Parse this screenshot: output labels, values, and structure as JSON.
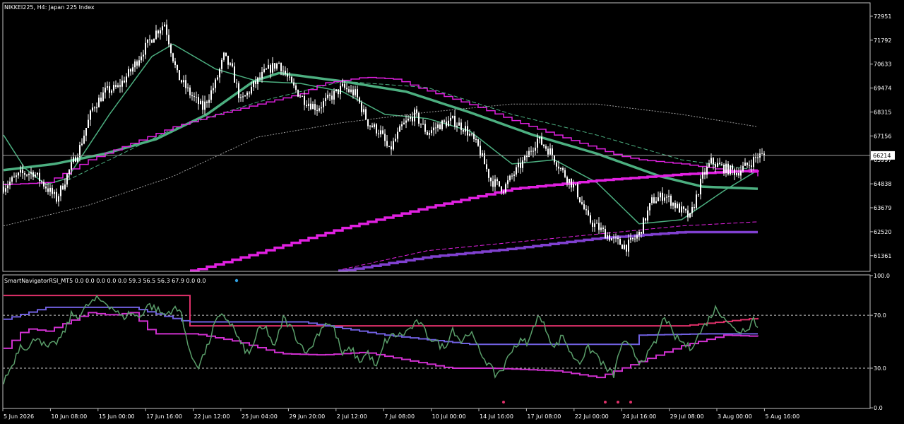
{
  "window": {
    "title": "NIKKEI225, H4:  Japan 225 Index",
    "indicator_label": "SmartNavigatorRSI_MT5 0.0 0.0 0.0 0.0 0.0 59.3 56.5 56.3 67.9 0.0 0.0",
    "current_price": "66214"
  },
  "colors": {
    "background": "#000000",
    "grid": "#c0c0c0",
    "text": "#ffffff",
    "candle": "#ffffff",
    "ma_green": "#4caf80",
    "magenta": "#e020e0",
    "purple": "#8040d0",
    "rsi_line": "#5a9e6a",
    "rsi_red": "#e0306a",
    "rsi_blue": "#7060e0",
    "rsi_magenta": "#d030d0",
    "dot_pink": "#e0306a",
    "dot_blue": "#30a0e0"
  },
  "chart_data": [
    {
      "type": "candlestick",
      "symbol": "NIKKEI225",
      "timeframe": "H4",
      "ylim": [
        60600,
        73600
      ],
      "y_ticks": [
        "72951",
        "71792",
        "70633",
        "69474",
        "68315",
        "67156",
        "65997",
        "64838",
        "63679",
        "62520",
        "61361"
      ],
      "x_ticks": [
        "5 Jun 2026",
        "10 Jun 08:00",
        "15 Jun 00:00",
        "17 Jun 16:00",
        "22 Jun 12:00",
        "25 Jun 04:00",
        "29 Jun 20:00",
        "2 Jul 12:00",
        "7 Jul 08:00",
        "10 Jul 00:00",
        "14 Jul 16:00",
        "17 Jul 08:00",
        "22 Jul 00:00",
        "24 Jul 16:00",
        "29 Jul 08:00",
        "3 Aug 00:00",
        "5 Aug 16:00"
      ],
      "price_anchors": [
        [
          0,
          64700
        ],
        [
          8,
          65300
        ],
        [
          14,
          65400
        ],
        [
          20,
          64700
        ],
        [
          25,
          64100
        ],
        [
          32,
          65700
        ],
        [
          36,
          66600
        ],
        [
          42,
          68500
        ],
        [
          48,
          69300
        ],
        [
          54,
          69500
        ],
        [
          60,
          70300
        ],
        [
          66,
          71300
        ],
        [
          72,
          72200
        ],
        [
          76,
          72600
        ],
        [
          82,
          70100
        ],
        [
          88,
          69200
        ],
        [
          94,
          68500
        ],
        [
          100,
          69700
        ],
        [
          104,
          71000
        ],
        [
          108,
          70300
        ],
        [
          112,
          68800
        ],
        [
          118,
          69600
        ],
        [
          124,
          70300
        ],
        [
          130,
          70700
        ],
        [
          136,
          69600
        ],
        [
          142,
          68900
        ],
        [
          148,
          68500
        ],
        [
          154,
          69000
        ],
        [
          160,
          69500
        ],
        [
          166,
          69200
        ],
        [
          172,
          67800
        ],
        [
          178,
          67300
        ],
        [
          182,
          66400
        ],
        [
          188,
          67600
        ],
        [
          194,
          68200
        ],
        [
          200,
          67300
        ],
        [
          206,
          67700
        ],
        [
          212,
          67900
        ],
        [
          218,
          67500
        ],
        [
          224,
          66600
        ],
        [
          230,
          65000
        ],
        [
          236,
          64600
        ],
        [
          240,
          65200
        ],
        [
          246,
          66000
        ],
        [
          252,
          67000
        ],
        [
          258,
          66400
        ],
        [
          264,
          65400
        ],
        [
          270,
          64600
        ],
        [
          276,
          63100
        ],
        [
          282,
          62600
        ],
        [
          288,
          62100
        ],
        [
          294,
          61800
        ],
        [
          300,
          62400
        ],
        [
          306,
          64000
        ],
        [
          312,
          64300
        ],
        [
          318,
          63700
        ],
        [
          324,
          63200
        ],
        [
          330,
          65200
        ],
        [
          334,
          65900
        ],
        [
          340,
          65600
        ],
        [
          346,
          65400
        ],
        [
          352,
          65800
        ],
        [
          356,
          66200
        ]
      ],
      "series": [
        {
          "name": "",
          "style": "thick",
          "anchors": [
            [
              0,
              65500
            ],
            [
              24,
              65800
            ],
            [
              48,
              66300
            ],
            [
              72,
              67000
            ],
            [
              96,
              68200
            ],
            [
              118,
              69800
            ],
            [
              130,
              70200
            ],
            [
              160,
              69800
            ],
            [
              190,
              69300
            ],
            [
              220,
              68300
            ],
            [
              250,
              67200
            ],
            [
              280,
              66300
            ],
            [
              310,
              65200
            ],
            [
              330,
              64700
            ],
            [
              356,
              64600
            ]
          ]
        },
        {
          "name": "",
          "style": "thin",
          "anchors": [
            [
              0,
              67200
            ],
            [
              10,
              65600
            ],
            [
              20,
              64800
            ],
            [
              30,
              65100
            ],
            [
              50,
              68200
            ],
            [
              70,
              71000
            ],
            [
              80,
              71600
            ],
            [
              100,
              70400
            ],
            [
              120,
              69800
            ],
            [
              140,
              69700
            ],
            [
              160,
              69300
            ],
            [
              180,
              68200
            ],
            [
              200,
              68000
            ],
            [
              220,
              67400
            ],
            [
              240,
              65800
            ],
            [
              260,
              66000
            ],
            [
              280,
              64900
            ],
            [
              300,
              62900
            ],
            [
              320,
              63100
            ],
            [
              340,
              64500
            ],
            [
              356,
              65500
            ]
          ]
        },
        {
          "name": "",
          "style": "dashed",
          "anchors": [
            [
              0,
              62800
            ],
            [
              40,
              63800
            ],
            [
              80,
              65200
            ],
            [
              120,
              67100
            ],
            [
              160,
              67800
            ],
            [
              200,
              68300
            ],
            [
              240,
              68700
            ],
            [
              280,
              68700
            ],
            [
              320,
              68200
            ],
            [
              356,
              67600
            ]
          ]
        },
        {
          "name": "",
          "style": "thin-dashed",
          "anchors": [
            [
              30,
              65000
            ],
            [
              80,
              67500
            ],
            [
              120,
              68800
            ],
            [
              160,
              69800
            ],
            [
              200,
              69500
            ],
            [
              240,
              68200
            ],
            [
              280,
              67200
            ],
            [
              320,
              66000
            ],
            [
              356,
              65500
            ]
          ]
        },
        {
          "name": "",
          "style": "magenta-step",
          "anchors": [
            [
              0,
              64800
            ],
            [
              20,
              64900
            ],
            [
              40,
              66000
            ],
            [
              60,
              66800
            ],
            [
              80,
              67600
            ],
            [
              100,
              68200
            ],
            [
              120,
              68700
            ],
            [
              140,
              69200
            ],
            [
              150,
              69700
            ],
            [
              170,
              70000
            ],
            [
              185,
              69900
            ],
            [
              195,
              69500
            ],
            [
              210,
              69000
            ],
            [
              225,
              68500
            ],
            [
              240,
              67900
            ],
            [
              260,
              67200
            ],
            [
              275,
              66700
            ],
            [
              290,
              66200
            ],
            [
              300,
              66000
            ],
            [
              320,
              65800
            ],
            [
              340,
              65500
            ],
            [
              352,
              65400
            ],
            [
              356,
              65200
            ]
          ]
        },
        {
          "name": "",
          "style": "thick-magenta-step",
          "anchors": [
            [
              88,
              60600
            ],
            [
              120,
              61500
            ],
            [
              160,
              62700
            ],
            [
              200,
              63700
            ],
            [
              240,
              64600
            ],
            [
              280,
              65000
            ],
            [
              320,
              65300
            ],
            [
              356,
              65500
            ]
          ]
        },
        {
          "name": "",
          "style": "thick-purple-step",
          "anchors": [
            [
              158,
              60600
            ],
            [
              200,
              61300
            ],
            [
              240,
              61700
            ],
            [
              280,
              62200
            ],
            [
              320,
              62500
            ],
            [
              354,
              62500
            ],
            [
              356,
              63000
            ]
          ]
        },
        {
          "name": "",
          "style": "thin-magenta-dashed",
          "anchors": [
            [
              160,
              60700
            ],
            [
              200,
              61600
            ],
            [
              240,
              62000
            ],
            [
              280,
              62400
            ],
            [
              320,
              62800
            ],
            [
              356,
              63000
            ]
          ]
        }
      ]
    },
    {
      "type": "line",
      "indicator": "SmartNavigatorRSI_MT5",
      "ylim": [
        0,
        100
      ],
      "y_ticks": [
        "100.0",
        "70.0",
        "30.0",
        "0.0"
      ],
      "levels": [
        70,
        30
      ],
      "rsi_anchors": [
        [
          0,
          20
        ],
        [
          4,
          32
        ],
        [
          8,
          48
        ],
        [
          12,
          45
        ],
        [
          16,
          55
        ],
        [
          20,
          45
        ],
        [
          24,
          48
        ],
        [
          28,
          55
        ],
        [
          32,
          70
        ],
        [
          36,
          70
        ],
        [
          40,
          78
        ],
        [
          44,
          82
        ],
        [
          48,
          80
        ],
        [
          52,
          75
        ],
        [
          56,
          68
        ],
        [
          60,
          72
        ],
        [
          64,
          68
        ],
        [
          68,
          78
        ],
        [
          72,
          75
        ],
        [
          76,
          70
        ],
        [
          80,
          75
        ],
        [
          84,
          72
        ],
        [
          88,
          40
        ],
        [
          92,
          32
        ],
        [
          96,
          45
        ],
        [
          100,
          65
        ],
        [
          104,
          70
        ],
        [
          108,
          62
        ],
        [
          112,
          48
        ],
        [
          116,
          40
        ],
        [
          120,
          58
        ],
        [
          124,
          60
        ],
        [
          128,
          45
        ],
        [
          132,
          68
        ],
        [
          136,
          60
        ],
        [
          140,
          48
        ],
        [
          144,
          42
        ],
        [
          148,
          55
        ],
        [
          152,
          65
        ],
        [
          156,
          60
        ],
        [
          160,
          40
        ],
        [
          164,
          45
        ],
        [
          168,
          35
        ],
        [
          172,
          42
        ],
        [
          176,
          30
        ],
        [
          180,
          50
        ],
        [
          184,
          55
        ],
        [
          188,
          55
        ],
        [
          192,
          60
        ],
        [
          196,
          65
        ],
        [
          200,
          55
        ],
        [
          204,
          50
        ],
        [
          208,
          45
        ],
        [
          212,
          60
        ],
        [
          216,
          50
        ],
        [
          220,
          58
        ],
        [
          224,
          45
        ],
        [
          228,
          35
        ],
        [
          232,
          25
        ],
        [
          236,
          30
        ],
        [
          240,
          45
        ],
        [
          244,
          50
        ],
        [
          248,
          50
        ],
        [
          252,
          70
        ],
        [
          256,
          60
        ],
        [
          260,
          45
        ],
        [
          264,
          55
        ],
        [
          268,
          40
        ],
        [
          272,
          35
        ],
        [
          276,
          45
        ],
        [
          280,
          40
        ],
        [
          284,
          30
        ],
        [
          288,
          25
        ],
        [
          292,
          50
        ],
        [
          296,
          45
        ],
        [
          300,
          35
        ],
        [
          304,
          40
        ],
        [
          308,
          50
        ],
        [
          312,
          70
        ],
        [
          316,
          55
        ],
        [
          320,
          50
        ],
        [
          324,
          45
        ],
        [
          328,
          55
        ],
        [
          332,
          65
        ],
        [
          336,
          75
        ],
        [
          340,
          70
        ],
        [
          344,
          60
        ],
        [
          348,
          58
        ],
        [
          352,
          62
        ],
        [
          354,
          68
        ],
        [
          356,
          60
        ]
      ],
      "red_steps": [
        [
          0,
          85
        ],
        [
          86,
          85
        ],
        [
          86,
          62
        ],
        [
          170,
          62
        ],
        [
          230,
          62
        ],
        [
          320,
          62
        ],
        [
          356,
          68
        ]
      ],
      "blue_steps": [
        [
          0,
          67
        ],
        [
          20,
          76
        ],
        [
          40,
          76
        ],
        [
          60,
          76
        ],
        [
          86,
          65
        ],
        [
          140,
          65
        ],
        [
          180,
          55
        ],
        [
          220,
          48
        ],
        [
          260,
          48
        ],
        [
          298,
          48
        ],
        [
          300,
          55
        ],
        [
          330,
          56
        ],
        [
          356,
          56
        ]
      ],
      "magenta_steps": [
        [
          0,
          45
        ],
        [
          10,
          60
        ],
        [
          20,
          58
        ],
        [
          30,
          65
        ],
        [
          40,
          72
        ],
        [
          50,
          70
        ],
        [
          60,
          72
        ],
        [
          70,
          56
        ],
        [
          90,
          56
        ],
        [
          110,
          50
        ],
        [
          130,
          41
        ],
        [
          150,
          40
        ],
        [
          170,
          42
        ],
        [
          190,
          36
        ],
        [
          210,
          30
        ],
        [
          230,
          30
        ],
        [
          260,
          28
        ],
        [
          280,
          23
        ],
        [
          300,
          35
        ],
        [
          320,
          47
        ],
        [
          340,
          55
        ],
        [
          356,
          54
        ]
      ],
      "dot_indices": [
        236,
        284,
        290,
        296
      ]
    }
  ]
}
